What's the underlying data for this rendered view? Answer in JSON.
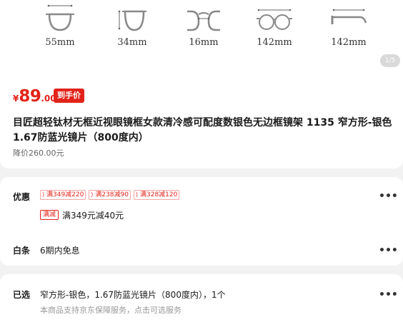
{
  "gallery": {
    "dimensions": [
      {
        "icon": "lens-width-icon",
        "label": "55mm"
      },
      {
        "icon": "lens-height-icon",
        "label": "34mm"
      },
      {
        "icon": "bridge-width-icon",
        "label": "16mm"
      },
      {
        "icon": "frame-width-icon",
        "label": "142mm"
      },
      {
        "icon": "temple-length-icon",
        "label": "142mm"
      }
    ],
    "counter": "1/5"
  },
  "price": {
    "currency": "¥",
    "integer": "89",
    "decimal": ".00",
    "tag": "到手价",
    "original": "降价260.00元"
  },
  "product": {
    "title": "目匠超轻钛材无框近视眼镜框女款清冷感可配度数银色无边框镜架 1135 窄方形-银色 1.67防蓝光镜片（800度内）"
  },
  "promo": {
    "label": "优惠",
    "coupons": [
      "满349减220",
      "满238减90",
      "满328减120"
    ],
    "badge": "满减",
    "detail": "满349元减40元"
  },
  "baitiao": {
    "label": "白条",
    "detail": "6期内免息"
  },
  "selection": {
    "label": "已选",
    "value": "窄方形-银色，1.67防蓝光镜片（800度内），1个",
    "note": "本商品支持京东保障服务，点击可选服务"
  },
  "colors": {
    "accent": "#e2231a",
    "background": "#f2f2f2",
    "card": "#ffffff"
  },
  "icons": {
    "more": "more-dots-icon"
  }
}
